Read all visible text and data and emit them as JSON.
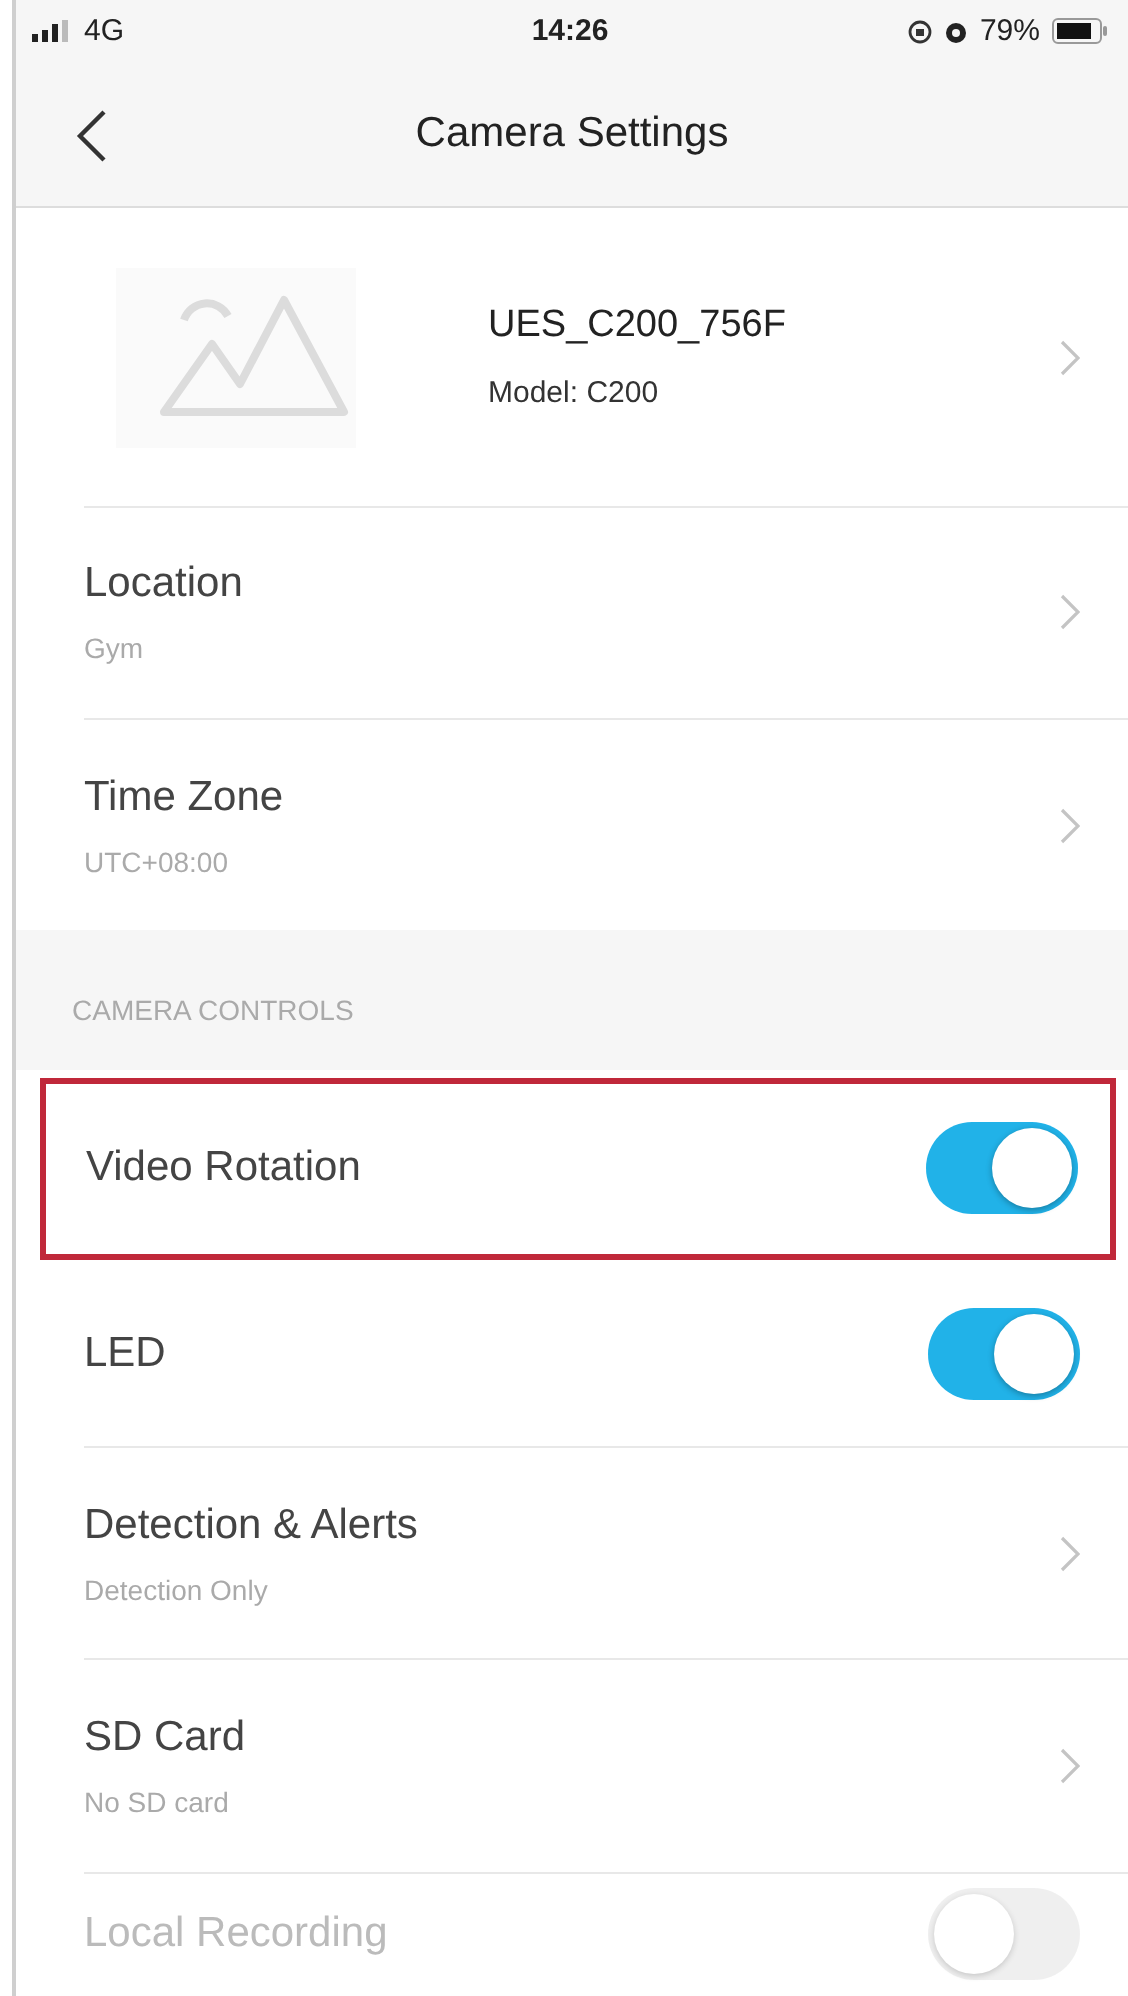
{
  "status_bar": {
    "carrier": "4G",
    "time": "14:26",
    "battery": "79%"
  },
  "nav": {
    "title": "Camera Settings"
  },
  "device": {
    "name": "UES_C200_756F",
    "model": "Model: C200"
  },
  "general": [
    {
      "kind": "link",
      "title": "Location",
      "subtitle": "Gym"
    },
    {
      "kind": "link",
      "title": "Time Zone",
      "subtitle": "UTC+08:00"
    }
  ],
  "camera_controls": {
    "header": "CAMERA CONTROLS",
    "items": [
      {
        "kind": "toggle",
        "title": "Video Rotation",
        "on": true,
        "disabled": false,
        "highlighted": true
      },
      {
        "kind": "toggle",
        "title": "LED",
        "on": true,
        "disabled": false,
        "highlighted": false
      },
      {
        "kind": "link",
        "title": "Detection & Alerts",
        "subtitle": "Detection Only"
      },
      {
        "kind": "link",
        "title": "SD Card",
        "subtitle": "No SD card"
      },
      {
        "kind": "toggle",
        "title": "Local Recording",
        "on": false,
        "disabled": true,
        "highlighted": false
      }
    ]
  }
}
